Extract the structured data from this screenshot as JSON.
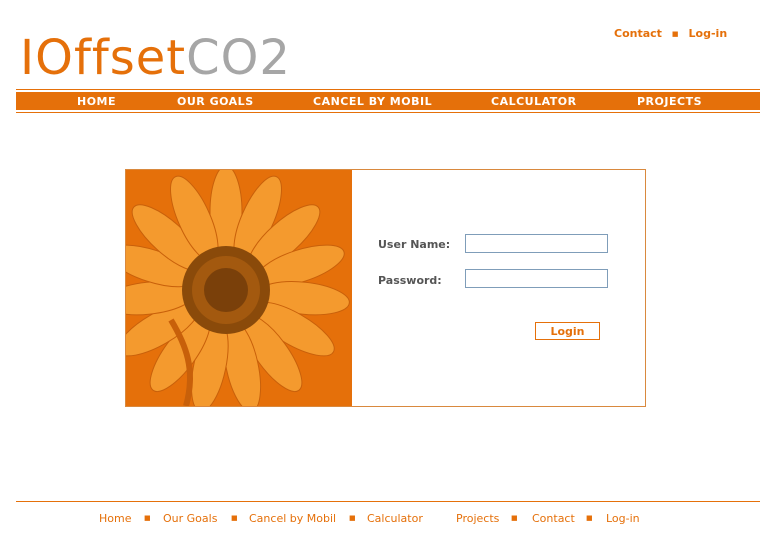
{
  "brand": {
    "logo_part1": "IOffset",
    "logo_part2": "CO2"
  },
  "top_links": {
    "contact": "Contact",
    "separator": "■",
    "login": "Log-in"
  },
  "nav": {
    "home": "HOME",
    "our_goals": "OUR GOALS",
    "cancel_by_mobil": "CANCEL BY MOBIL",
    "calculator": "CALCULATOR",
    "projects": "PROJECTS"
  },
  "login_form": {
    "username_label": "User Name:",
    "password_label": "Password:",
    "username_value": "",
    "password_value": "",
    "submit_label": "Login"
  },
  "footer": {
    "home": "Home",
    "our_goals": "Our Goals",
    "cancel_by_mobil": "Cancel by Mobil",
    "calculator": "Calculator",
    "projects": "Projects",
    "contact": "Contact",
    "login": "Log-in",
    "separator": "■"
  },
  "colors": {
    "accent": "#e5700a",
    "logo_gray": "#a6a6a6",
    "field_border": "#7f9db9"
  }
}
